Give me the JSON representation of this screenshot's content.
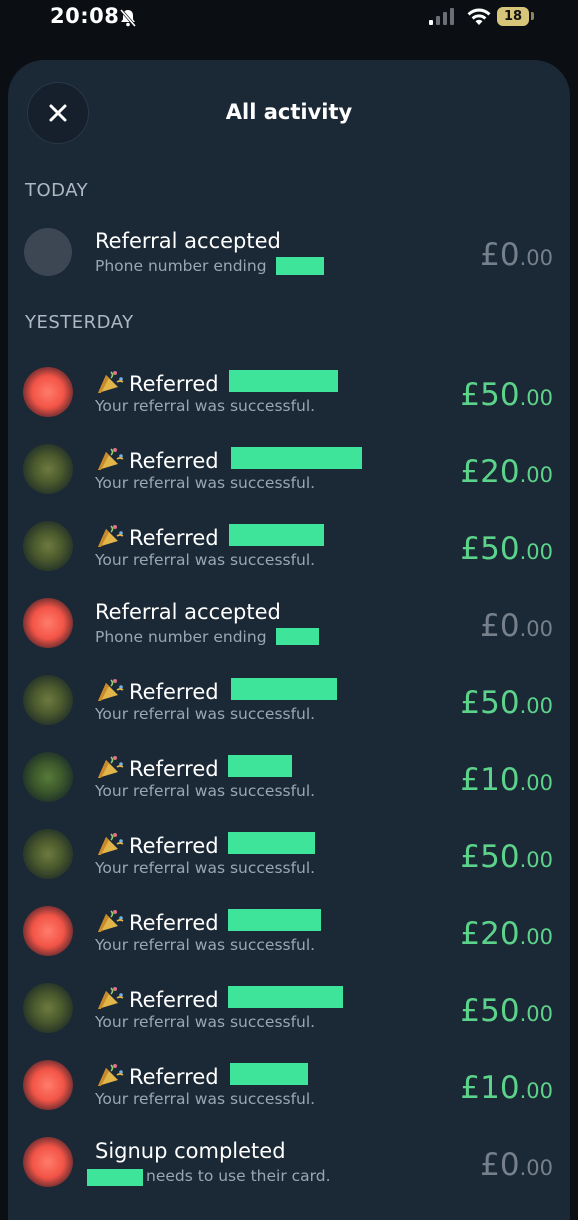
{
  "status_bar": {
    "time": "20:08",
    "battery": "18"
  },
  "header": {
    "title": "All activity"
  },
  "sections": {
    "today": "TODAY",
    "yesterday": "YESTERDAY"
  },
  "rows": [
    {
      "title": "Referral accepted",
      "subtitle": "Phone number ending",
      "amount_main": "£0",
      "amount_dec": ".00",
      "status": "zero"
    },
    {
      "title": "Referred",
      "subtitle": "Your referral was successful.",
      "amount_main": "£50",
      "amount_dec": ".00",
      "status": "credit"
    },
    {
      "title": "Referred",
      "subtitle": "Your referral was successful.",
      "amount_main": "£20",
      "amount_dec": ".00",
      "status": "credit"
    },
    {
      "title": "Referred",
      "subtitle": "Your referral was successful.",
      "amount_main": "£50",
      "amount_dec": ".00",
      "status": "credit"
    },
    {
      "title": "Referral accepted",
      "subtitle": "Phone number ending",
      "amount_main": "£0",
      "amount_dec": ".00",
      "status": "zero"
    },
    {
      "title": "Referred",
      "subtitle": "Your referral was successful.",
      "amount_main": "£50",
      "amount_dec": ".00",
      "status": "credit"
    },
    {
      "title": "Referred",
      "subtitle": "Your referral was successful.",
      "amount_main": "£10",
      "amount_dec": ".00",
      "status": "credit"
    },
    {
      "title": "Referred",
      "subtitle": "Your referral was successful.",
      "amount_main": "£50",
      "amount_dec": ".00",
      "status": "credit"
    },
    {
      "title": "Referred",
      "subtitle": "Your referral was successful.",
      "amount_main": "£20",
      "amount_dec": ".00",
      "status": "credit"
    },
    {
      "title": "Referred",
      "subtitle": "Your referral was successful.",
      "amount_main": "£50",
      "amount_dec": ".00",
      "status": "credit"
    },
    {
      "title": "Referred",
      "subtitle": "Your referral was successful.",
      "amount_main": "£10",
      "amount_dec": ".00",
      "status": "credit"
    },
    {
      "title": "Signup completed",
      "subtitle": "needs to use their card.",
      "amount_main": "£0",
      "amount_dec": ".00",
      "status": "zero"
    }
  ],
  "colors": {
    "sheet_background": "#1b2835",
    "credit_amount": "#5bd38a",
    "zero_amount": "#76808b",
    "redaction": "#3ee49a"
  }
}
